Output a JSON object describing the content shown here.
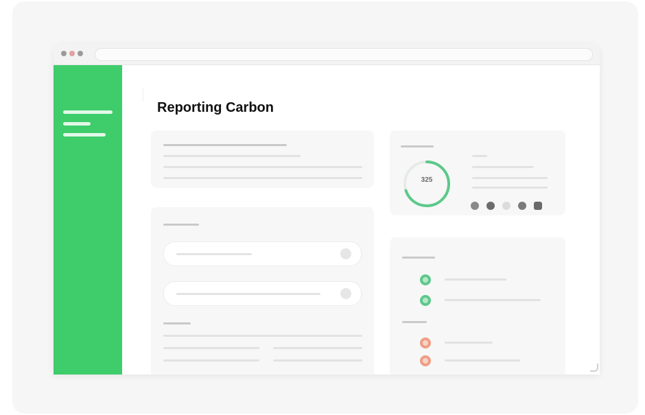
{
  "page": {
    "title": "Reporting Carbon"
  },
  "score": {
    "value": "325"
  },
  "colors": {
    "sidebar": "#3fcc6b",
    "ring_progress": "#5cc98a",
    "positive": "#5fc98c",
    "warning": "#ee9e86"
  },
  "icons": {
    "window_controls": [
      "close-dot",
      "minimize-dot",
      "maximize-dot"
    ],
    "summary_circles": [
      "circle-icon-1",
      "circle-icon-2",
      "circle-icon-3",
      "circle-icon-4",
      "circle-icon-5"
    ]
  },
  "score_ring": {
    "fraction": 0.7
  }
}
